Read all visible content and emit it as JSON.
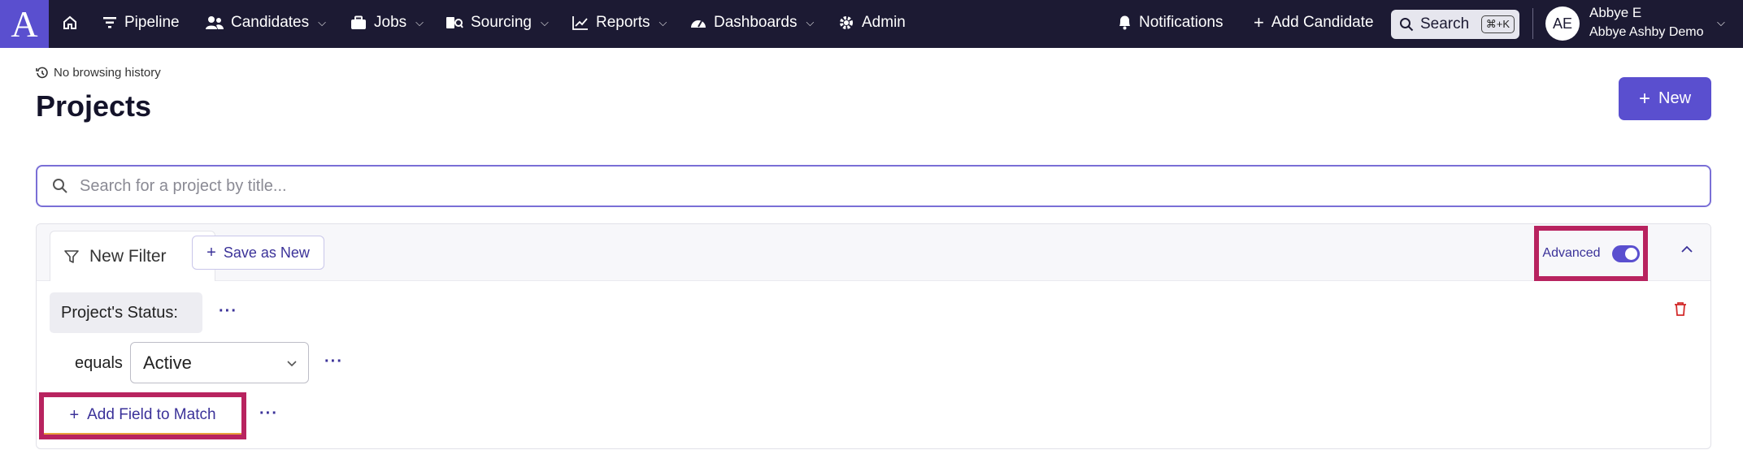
{
  "nav": {
    "logo_letter": "A",
    "items": [
      {
        "label": "Pipeline",
        "icon": "filter-icon",
        "has_dropdown": false
      },
      {
        "label": "Candidates",
        "icon": "users-icon",
        "has_dropdown": true
      },
      {
        "label": "Jobs",
        "icon": "briefcase-icon",
        "has_dropdown": true
      },
      {
        "label": "Sourcing",
        "icon": "sourcing-icon",
        "has_dropdown": true
      },
      {
        "label": "Reports",
        "icon": "chart-icon",
        "has_dropdown": true
      },
      {
        "label": "Dashboards",
        "icon": "gauge-icon",
        "has_dropdown": true
      },
      {
        "label": "Admin",
        "icon": "gear-icon",
        "has_dropdown": false
      }
    ],
    "notifications_label": "Notifications",
    "add_candidate_label": "Add Candidate",
    "search_label": "Search",
    "search_shortcut": "⌘+K",
    "user": {
      "initials": "AE",
      "name": "Abbye E",
      "org": "Abbye Ashby Demo"
    }
  },
  "header": {
    "history_text": "No browsing history",
    "title": "Projects",
    "new_button_label": "New"
  },
  "search": {
    "placeholder": "Search for a project by title..."
  },
  "filter": {
    "tab_label": "New Filter",
    "save_as_new_label": "Save as New",
    "advanced_label": "Advanced",
    "advanced_enabled": true,
    "field_label": "Project's Status:",
    "operator": "equals",
    "selected_value": "Active",
    "add_field_label": "Add Field to Match",
    "more_glyph": "···"
  },
  "colors": {
    "nav_bg": "#1c1a33",
    "accent": "#5a4fcf",
    "highlight_border": "#b8235f",
    "delete": "#d22a2a"
  }
}
